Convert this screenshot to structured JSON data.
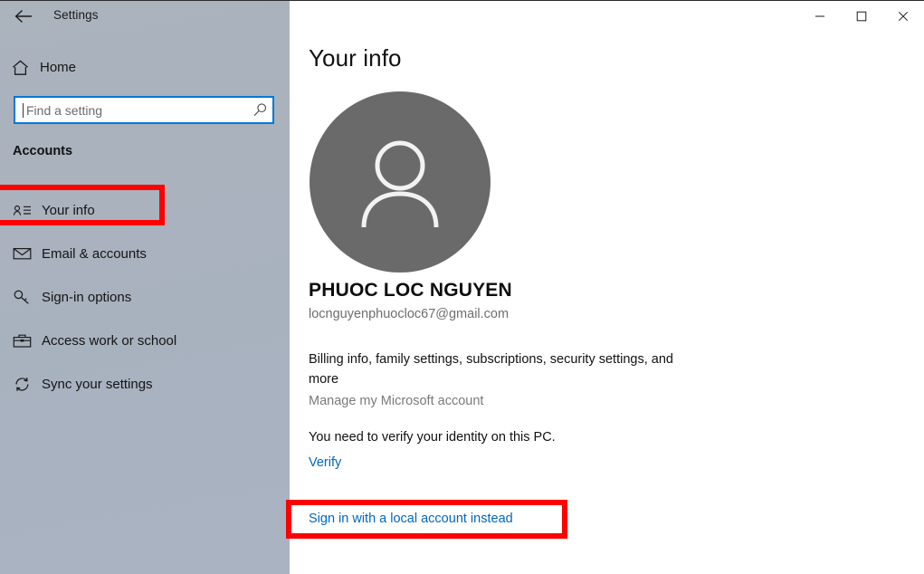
{
  "window": {
    "back_icon": "back-arrow-icon",
    "title": "Settings",
    "controls": [
      {
        "name": "minimize",
        "glyph": "─"
      },
      {
        "name": "maximize",
        "glyph": "□"
      },
      {
        "name": "close",
        "glyph": "✕"
      }
    ]
  },
  "sidebar": {
    "home": {
      "label": "Home",
      "icon": "home-icon"
    },
    "search": {
      "value": "",
      "placeholder": "Find a setting",
      "icon": "search-icon"
    },
    "section_title": "Accounts",
    "items": [
      {
        "label": "Your info",
        "icon": "contact-card-icon",
        "selected": true
      },
      {
        "label": "Email & accounts",
        "icon": "envelope-icon",
        "selected": false
      },
      {
        "label": "Sign-in options",
        "icon": "key-icon",
        "selected": false
      },
      {
        "label": "Access work or school",
        "icon": "briefcase-icon",
        "selected": false
      },
      {
        "label": "Sync your settings",
        "icon": "sync-icon",
        "selected": false
      }
    ]
  },
  "main": {
    "page_title": "Your info",
    "avatar_icon": "person-avatar-icon",
    "account_name": "PHUOC LOC NGUYEN",
    "account_email": "locnguyenphuocloc67@gmail.com",
    "billing_text": "Billing info, family settings, subscriptions, security settings, and more",
    "manage_account_link": "Manage my Microsoft account",
    "verify_text": "You need to verify your identity on this PC.",
    "verify_link": "Verify",
    "local_account_link": "Sign in with a local account instead"
  },
  "annotations": {
    "highlight_color": "#fe0000",
    "boxes": [
      {
        "name": "your-info-highlight",
        "target": "Your info"
      },
      {
        "name": "local-account-highlight",
        "target": "Sign in with a local account instead"
      }
    ]
  },
  "colors": {
    "accent_blue": "#0078d7",
    "link_blue": "#0067c0",
    "sidebar_bg": "#a9b2bd",
    "avatar_bg": "#6a6a6a",
    "highlight_red": "#fe0000"
  }
}
